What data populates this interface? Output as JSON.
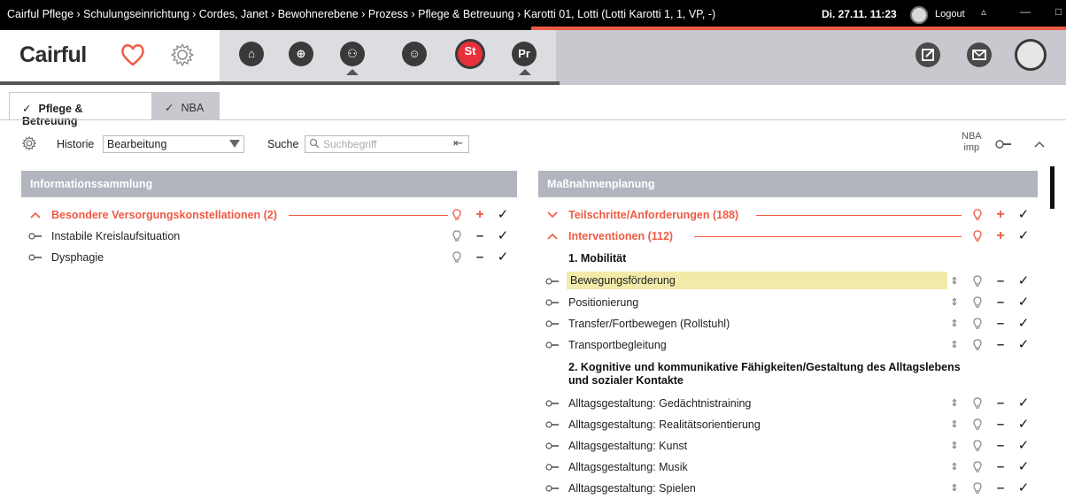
{
  "titlebar": {
    "path": "Cairful Pflege › Schulungseinrichtung › Cordes, Janet › Bewohnerebene › Prozess › Pflege & Betreuung › Karotti 01, Lotti  (Lotti Karotti 1, 1, VP, -)",
    "datetime": "Di. 27.11. 11:23",
    "logout": "Logout"
  },
  "header": {
    "logo": "Cairful",
    "nav": [
      {
        "icon": "heart-icon"
      },
      {
        "icon": "gear-icon"
      },
      {
        "icon": "home-icon"
      },
      {
        "icon": "house-group-icon"
      },
      {
        "icon": "people-icon"
      },
      {
        "icon": "resident-avatar-icon"
      },
      {
        "icon": "st-icon",
        "label": "St"
      },
      {
        "icon": "pr-icon",
        "label": "Pr"
      }
    ],
    "right": [
      {
        "icon": "edit-icon"
      },
      {
        "icon": "mail-icon"
      },
      {
        "icon": "user-avatar-icon"
      }
    ]
  },
  "tabs": [
    {
      "label": "Pflege & Betreuung",
      "active": true
    },
    {
      "label": "NBA",
      "active": false
    }
  ],
  "toolbar": {
    "historie_label": "Historie",
    "historie_value": "Bearbeitung",
    "suche_label": "Suche",
    "suche_placeholder": "Suchbegriff",
    "nba_line1": "NBA",
    "nba_line2": "imp"
  },
  "left_panel": {
    "title": "Informationssammlung",
    "section": {
      "label": "Besondere Versorgungskonstellationen (2)",
      "expanded": true
    },
    "items": [
      "Instabile Kreislaufsituation",
      "Dysphagie"
    ]
  },
  "right_panel": {
    "title": "Maßnahmenplanung",
    "sections": [
      {
        "label": "Teilschritte/Anforderungen (188)",
        "expanded": false
      },
      {
        "label": "Interventionen (112)",
        "expanded": true
      }
    ],
    "categories": [
      {
        "title": "1. Mobilität",
        "items": [
          "Bewegungsförderung",
          "Positionierung",
          "Transfer/Fortbewegen (Rollstuhl)",
          "Transportbegleitung"
        ]
      },
      {
        "title": "2. Kognitive und kommunikative Fähigkeiten/Gestaltung des Alltagslebens und sozialer Kontakte",
        "items": [
          "Alltagsgestaltung: Gedächtnistraining",
          "Alltagsgestaltung: Realitätsorientierung",
          "Alltagsgestaltung: Kunst",
          "Alltagsgestaltung: Musik",
          "Alltagsgestaltung: Spielen"
        ]
      }
    ],
    "highlighted_item": "Bewegungsförderung"
  },
  "colors": {
    "accent": "#ef5a44",
    "panel_header": "#b2b5bd",
    "highlight": "#f2eaa9"
  }
}
